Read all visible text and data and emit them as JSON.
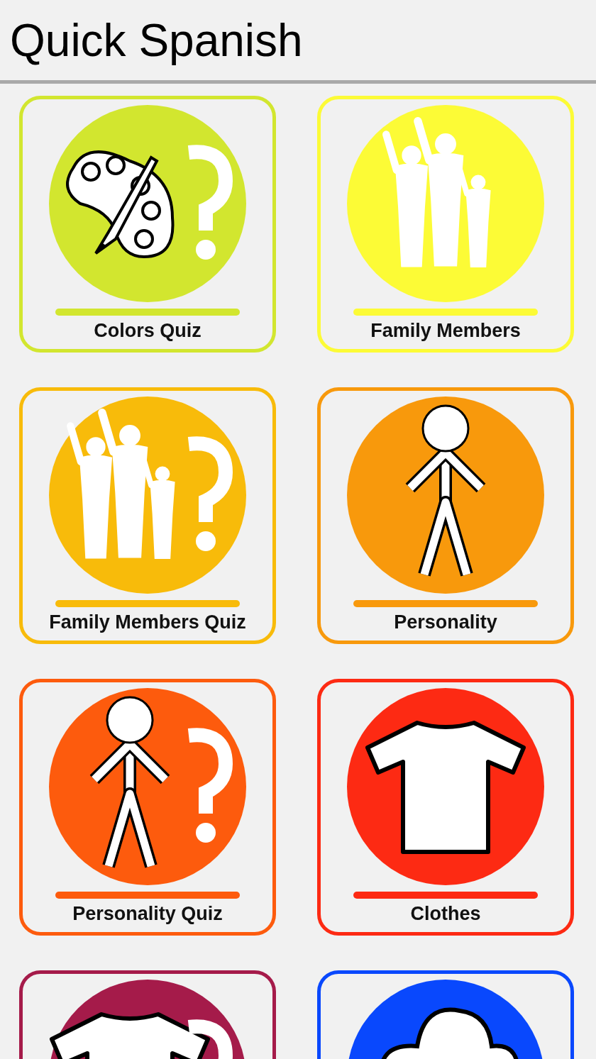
{
  "title": "Quick Spanish",
  "tiles": [
    {
      "label": "Colors Quiz",
      "kind": "palette",
      "quiz": true,
      "color": "#d2e62f"
    },
    {
      "label": "Family Members",
      "kind": "family",
      "quiz": false,
      "color": "#fcfb36"
    },
    {
      "label": "Family Members Quiz",
      "kind": "family",
      "quiz": true,
      "color": "#f8bb0a"
    },
    {
      "label": "Personality",
      "kind": "person",
      "quiz": false,
      "color": "#f8990c"
    },
    {
      "label": "Personality Quiz",
      "kind": "person",
      "quiz": true,
      "color": "#fd5b0d"
    },
    {
      "label": "Clothes",
      "kind": "shirt",
      "quiz": false,
      "color": "#fd2a13"
    },
    {
      "kind": "shirt",
      "quiz": true,
      "color": "#a51b4a"
    },
    {
      "kind": "cloud",
      "quiz": false,
      "color": "#0948fd"
    }
  ]
}
